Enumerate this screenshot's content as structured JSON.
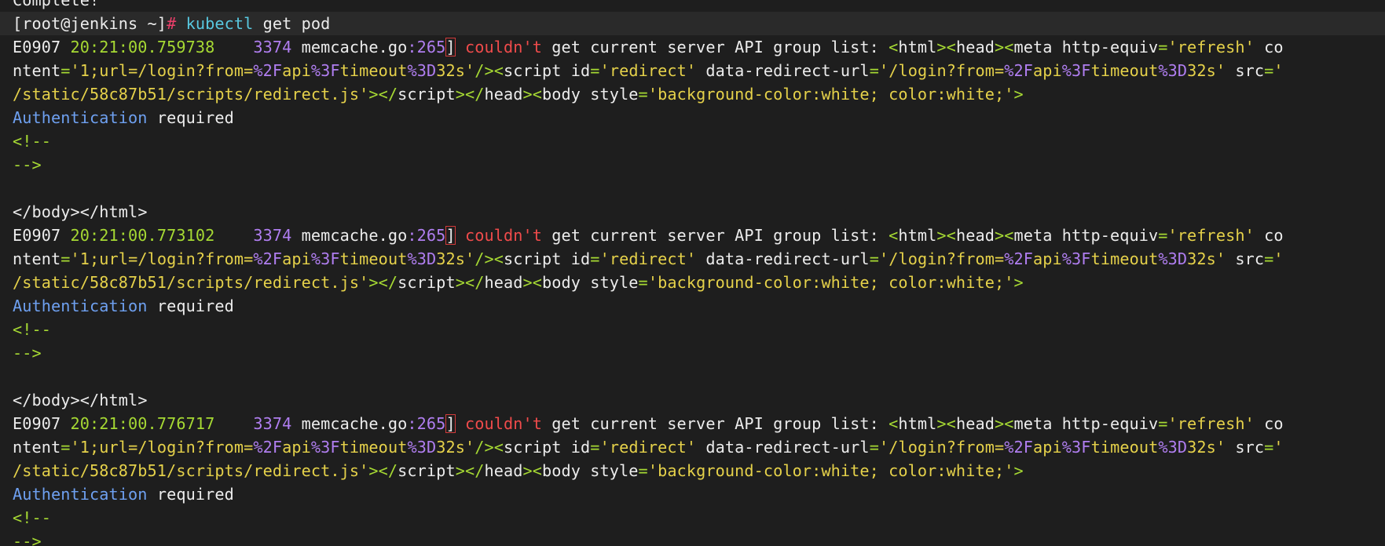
{
  "colors": {
    "background": "#1e1e1e",
    "prompt_line_bg": "#2a2a2a",
    "default": "#ececec",
    "prompt_hash": "#ec3f6a",
    "command": "#58c8e0",
    "timestamp": "#a6d933",
    "number": "#b07ef0",
    "error": "#f04b4b",
    "string": "#e5d14a",
    "html_punct": "#a6d933",
    "keyword_blue": "#6ea0f0"
  },
  "lines": [
    {
      "type": "text",
      "segments": [
        {
          "t": "Complete!",
          "c": "default"
        }
      ]
    },
    {
      "type": "prompt",
      "segments": [
        {
          "t": "[root@jenkins ~]",
          "c": "default"
        },
        {
          "t": "# ",
          "c": "prompt_hash"
        },
        {
          "t": "kubectl",
          "c": "command"
        },
        {
          "t": " get pod",
          "c": "default"
        }
      ]
    },
    {
      "type": "text",
      "segments": [
        {
          "t": "E0907 ",
          "c": "default"
        },
        {
          "t": "20:21:00.759738",
          "c": "timestamp"
        },
        {
          "t": "    ",
          "c": "default"
        },
        {
          "t": "3374",
          "c": "number"
        },
        {
          "t": " memcache.go",
          "c": "default"
        },
        {
          "t": ":265",
          "c": "number"
        },
        {
          "t": "]",
          "c": "default",
          "bracket": true
        },
        {
          "t": " couldn't",
          "c": "error"
        },
        {
          "t": " get current server API group list: ",
          "c": "default"
        },
        {
          "t": "<",
          "c": "html_punct"
        },
        {
          "t": "html",
          "c": "default"
        },
        {
          "t": "><",
          "c": "html_punct"
        },
        {
          "t": "head",
          "c": "default"
        },
        {
          "t": "><",
          "c": "html_punct"
        },
        {
          "t": "meta http-equiv",
          "c": "default"
        },
        {
          "t": "=",
          "c": "html_punct"
        },
        {
          "t": "'refresh'",
          "c": "string"
        },
        {
          "t": " co",
          "c": "default"
        }
      ]
    },
    {
      "type": "text",
      "segments": [
        {
          "t": "ntent",
          "c": "default"
        },
        {
          "t": "=",
          "c": "html_punct"
        },
        {
          "t": "'1;url=/login?from=",
          "c": "string"
        },
        {
          "t": "%2F",
          "c": "number"
        },
        {
          "t": "api",
          "c": "string"
        },
        {
          "t": "%3F",
          "c": "number"
        },
        {
          "t": "timeout",
          "c": "string"
        },
        {
          "t": "%3D",
          "c": "number"
        },
        {
          "t": "32s'",
          "c": "string"
        },
        {
          "t": "/><",
          "c": "html_punct"
        },
        {
          "t": "script id",
          "c": "default"
        },
        {
          "t": "=",
          "c": "html_punct"
        },
        {
          "t": "'redirect'",
          "c": "string"
        },
        {
          "t": " data-redirect-url",
          "c": "default"
        },
        {
          "t": "=",
          "c": "html_punct"
        },
        {
          "t": "'/login?from=",
          "c": "string"
        },
        {
          "t": "%2F",
          "c": "number"
        },
        {
          "t": "api",
          "c": "string"
        },
        {
          "t": "%3F",
          "c": "number"
        },
        {
          "t": "timeout",
          "c": "string"
        },
        {
          "t": "%3D",
          "c": "number"
        },
        {
          "t": "32s'",
          "c": "string"
        },
        {
          "t": " src",
          "c": "default"
        },
        {
          "t": "=",
          "c": "html_punct"
        },
        {
          "t": "'",
          "c": "string"
        }
      ]
    },
    {
      "type": "text",
      "segments": [
        {
          "t": "/static/58c87b51/scripts/redirect.js'",
          "c": "string"
        },
        {
          "t": "></",
          "c": "html_punct"
        },
        {
          "t": "script",
          "c": "default"
        },
        {
          "t": "></",
          "c": "html_punct"
        },
        {
          "t": "head",
          "c": "default"
        },
        {
          "t": "><",
          "c": "html_punct"
        },
        {
          "t": "body style",
          "c": "default"
        },
        {
          "t": "=",
          "c": "html_punct"
        },
        {
          "t": "'background-color:white; color:white;'",
          "c": "string"
        },
        {
          "t": ">",
          "c": "html_punct"
        }
      ]
    },
    {
      "type": "text",
      "segments": [
        {
          "t": "Authentication",
          "c": "keyword_blue"
        },
        {
          "t": " required",
          "c": "default"
        }
      ]
    },
    {
      "type": "text",
      "segments": [
        {
          "t": "<!--",
          "c": "html_punct"
        }
      ]
    },
    {
      "type": "text",
      "segments": [
        {
          "t": "-->",
          "c": "html_punct"
        }
      ]
    },
    {
      "type": "blank",
      "segments": []
    },
    {
      "type": "text",
      "segments": [
        {
          "t": "</",
          "c": "default"
        },
        {
          "t": "body",
          "c": "default"
        },
        {
          "t": "></",
          "c": "default"
        },
        {
          "t": "html",
          "c": "default"
        },
        {
          "t": ">",
          "c": "default"
        }
      ]
    },
    {
      "type": "text",
      "segments": [
        {
          "t": "E0907 ",
          "c": "default"
        },
        {
          "t": "20:21:00.773102",
          "c": "timestamp"
        },
        {
          "t": "    ",
          "c": "default"
        },
        {
          "t": "3374",
          "c": "number"
        },
        {
          "t": " memcache.go",
          "c": "default"
        },
        {
          "t": ":265",
          "c": "number"
        },
        {
          "t": "]",
          "c": "default",
          "bracket": true
        },
        {
          "t": " couldn't",
          "c": "error"
        },
        {
          "t": " get current server API group list: ",
          "c": "default"
        },
        {
          "t": "<",
          "c": "html_punct"
        },
        {
          "t": "html",
          "c": "default"
        },
        {
          "t": "><",
          "c": "html_punct"
        },
        {
          "t": "head",
          "c": "default"
        },
        {
          "t": "><",
          "c": "html_punct"
        },
        {
          "t": "meta http-equiv",
          "c": "default"
        },
        {
          "t": "=",
          "c": "html_punct"
        },
        {
          "t": "'refresh'",
          "c": "string"
        },
        {
          "t": " co",
          "c": "default"
        }
      ]
    },
    {
      "type": "text",
      "segments": [
        {
          "t": "ntent",
          "c": "default"
        },
        {
          "t": "=",
          "c": "html_punct"
        },
        {
          "t": "'1;url=/login?from=",
          "c": "string"
        },
        {
          "t": "%2F",
          "c": "number"
        },
        {
          "t": "api",
          "c": "string"
        },
        {
          "t": "%3F",
          "c": "number"
        },
        {
          "t": "timeout",
          "c": "string"
        },
        {
          "t": "%3D",
          "c": "number"
        },
        {
          "t": "32s'",
          "c": "string"
        },
        {
          "t": "/><",
          "c": "html_punct"
        },
        {
          "t": "script id",
          "c": "default"
        },
        {
          "t": "=",
          "c": "html_punct"
        },
        {
          "t": "'redirect'",
          "c": "string"
        },
        {
          "t": " data-redirect-url",
          "c": "default"
        },
        {
          "t": "=",
          "c": "html_punct"
        },
        {
          "t": "'/login?from=",
          "c": "string"
        },
        {
          "t": "%2F",
          "c": "number"
        },
        {
          "t": "api",
          "c": "string"
        },
        {
          "t": "%3F",
          "c": "number"
        },
        {
          "t": "timeout",
          "c": "string"
        },
        {
          "t": "%3D",
          "c": "number"
        },
        {
          "t": "32s'",
          "c": "string"
        },
        {
          "t": " src",
          "c": "default"
        },
        {
          "t": "=",
          "c": "html_punct"
        },
        {
          "t": "'",
          "c": "string"
        }
      ]
    },
    {
      "type": "text",
      "segments": [
        {
          "t": "/static/58c87b51/scripts/redirect.js'",
          "c": "string"
        },
        {
          "t": "></",
          "c": "html_punct"
        },
        {
          "t": "script",
          "c": "default"
        },
        {
          "t": "></",
          "c": "html_punct"
        },
        {
          "t": "head",
          "c": "default"
        },
        {
          "t": "><",
          "c": "html_punct"
        },
        {
          "t": "body style",
          "c": "default"
        },
        {
          "t": "=",
          "c": "html_punct"
        },
        {
          "t": "'background-color:white; color:white;'",
          "c": "string"
        },
        {
          "t": ">",
          "c": "html_punct"
        }
      ]
    },
    {
      "type": "text",
      "segments": [
        {
          "t": "Authentication",
          "c": "keyword_blue"
        },
        {
          "t": " required",
          "c": "default"
        }
      ]
    },
    {
      "type": "text",
      "segments": [
        {
          "t": "<!--",
          "c": "html_punct"
        }
      ]
    },
    {
      "type": "text",
      "segments": [
        {
          "t": "-->",
          "c": "html_punct"
        }
      ]
    },
    {
      "type": "blank",
      "segments": []
    },
    {
      "type": "text",
      "segments": [
        {
          "t": "</",
          "c": "default"
        },
        {
          "t": "body",
          "c": "default"
        },
        {
          "t": "></",
          "c": "default"
        },
        {
          "t": "html",
          "c": "default"
        },
        {
          "t": ">",
          "c": "default"
        }
      ]
    },
    {
      "type": "text",
      "segments": [
        {
          "t": "E0907 ",
          "c": "default"
        },
        {
          "t": "20:21:00.776717",
          "c": "timestamp"
        },
        {
          "t": "    ",
          "c": "default"
        },
        {
          "t": "3374",
          "c": "number"
        },
        {
          "t": " memcache.go",
          "c": "default"
        },
        {
          "t": ":265",
          "c": "number"
        },
        {
          "t": "]",
          "c": "default",
          "bracket": true
        },
        {
          "t": " couldn't",
          "c": "error"
        },
        {
          "t": " get current server API group list: ",
          "c": "default"
        },
        {
          "t": "<",
          "c": "html_punct"
        },
        {
          "t": "html",
          "c": "default"
        },
        {
          "t": "><",
          "c": "html_punct"
        },
        {
          "t": "head",
          "c": "default"
        },
        {
          "t": "><",
          "c": "html_punct"
        },
        {
          "t": "meta http-equiv",
          "c": "default"
        },
        {
          "t": "=",
          "c": "html_punct"
        },
        {
          "t": "'refresh'",
          "c": "string"
        },
        {
          "t": " co",
          "c": "default"
        }
      ]
    },
    {
      "type": "text",
      "segments": [
        {
          "t": "ntent",
          "c": "default"
        },
        {
          "t": "=",
          "c": "html_punct"
        },
        {
          "t": "'1;url=/login?from=",
          "c": "string"
        },
        {
          "t": "%2F",
          "c": "number"
        },
        {
          "t": "api",
          "c": "string"
        },
        {
          "t": "%3F",
          "c": "number"
        },
        {
          "t": "timeout",
          "c": "string"
        },
        {
          "t": "%3D",
          "c": "number"
        },
        {
          "t": "32s'",
          "c": "string"
        },
        {
          "t": "/><",
          "c": "html_punct"
        },
        {
          "t": "script id",
          "c": "default"
        },
        {
          "t": "=",
          "c": "html_punct"
        },
        {
          "t": "'redirect'",
          "c": "string"
        },
        {
          "t": " data-redirect-url",
          "c": "default"
        },
        {
          "t": "=",
          "c": "html_punct"
        },
        {
          "t": "'/login?from=",
          "c": "string"
        },
        {
          "t": "%2F",
          "c": "number"
        },
        {
          "t": "api",
          "c": "string"
        },
        {
          "t": "%3F",
          "c": "number"
        },
        {
          "t": "timeout",
          "c": "string"
        },
        {
          "t": "%3D",
          "c": "number"
        },
        {
          "t": "32s'",
          "c": "string"
        },
        {
          "t": " src",
          "c": "default"
        },
        {
          "t": "=",
          "c": "html_punct"
        },
        {
          "t": "'",
          "c": "string"
        }
      ]
    },
    {
      "type": "text",
      "segments": [
        {
          "t": "/static/58c87b51/scripts/redirect.js'",
          "c": "string"
        },
        {
          "t": "></",
          "c": "html_punct"
        },
        {
          "t": "script",
          "c": "default"
        },
        {
          "t": "></",
          "c": "html_punct"
        },
        {
          "t": "head",
          "c": "default"
        },
        {
          "t": "><",
          "c": "html_punct"
        },
        {
          "t": "body style",
          "c": "default"
        },
        {
          "t": "=",
          "c": "html_punct"
        },
        {
          "t": "'background-color:white; color:white;'",
          "c": "string"
        },
        {
          "t": ">",
          "c": "html_punct"
        }
      ]
    },
    {
      "type": "text",
      "segments": [
        {
          "t": "Authentication",
          "c": "keyword_blue"
        },
        {
          "t": " required",
          "c": "default"
        }
      ]
    },
    {
      "type": "text",
      "segments": [
        {
          "t": "<!--",
          "c": "html_punct"
        }
      ]
    },
    {
      "type": "text",
      "segments": [
        {
          "t": "-->",
          "c": "html_punct"
        }
      ]
    }
  ]
}
